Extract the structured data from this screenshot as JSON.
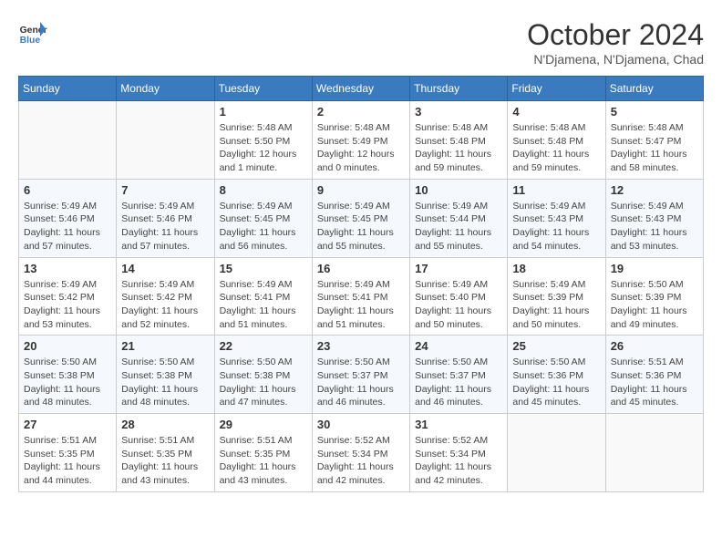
{
  "header": {
    "logo": {
      "line1": "General",
      "line2": "Blue"
    },
    "title": "October 2024",
    "location": "N'Djamena, N'Djamena, Chad"
  },
  "weekdays": [
    "Sunday",
    "Monday",
    "Tuesday",
    "Wednesday",
    "Thursday",
    "Friday",
    "Saturday"
  ],
  "weeks": [
    [
      {
        "day": "",
        "info": ""
      },
      {
        "day": "",
        "info": ""
      },
      {
        "day": "1",
        "info": "Sunrise: 5:48 AM\nSunset: 5:50 PM\nDaylight: 12 hours\nand 1 minute."
      },
      {
        "day": "2",
        "info": "Sunrise: 5:48 AM\nSunset: 5:49 PM\nDaylight: 12 hours\nand 0 minutes."
      },
      {
        "day": "3",
        "info": "Sunrise: 5:48 AM\nSunset: 5:48 PM\nDaylight: 11 hours\nand 59 minutes."
      },
      {
        "day": "4",
        "info": "Sunrise: 5:48 AM\nSunset: 5:48 PM\nDaylight: 11 hours\nand 59 minutes."
      },
      {
        "day": "5",
        "info": "Sunrise: 5:48 AM\nSunset: 5:47 PM\nDaylight: 11 hours\nand 58 minutes."
      }
    ],
    [
      {
        "day": "6",
        "info": "Sunrise: 5:49 AM\nSunset: 5:46 PM\nDaylight: 11 hours\nand 57 minutes."
      },
      {
        "day": "7",
        "info": "Sunrise: 5:49 AM\nSunset: 5:46 PM\nDaylight: 11 hours\nand 57 minutes."
      },
      {
        "day": "8",
        "info": "Sunrise: 5:49 AM\nSunset: 5:45 PM\nDaylight: 11 hours\nand 56 minutes."
      },
      {
        "day": "9",
        "info": "Sunrise: 5:49 AM\nSunset: 5:45 PM\nDaylight: 11 hours\nand 55 minutes."
      },
      {
        "day": "10",
        "info": "Sunrise: 5:49 AM\nSunset: 5:44 PM\nDaylight: 11 hours\nand 55 minutes."
      },
      {
        "day": "11",
        "info": "Sunrise: 5:49 AM\nSunset: 5:43 PM\nDaylight: 11 hours\nand 54 minutes."
      },
      {
        "day": "12",
        "info": "Sunrise: 5:49 AM\nSunset: 5:43 PM\nDaylight: 11 hours\nand 53 minutes."
      }
    ],
    [
      {
        "day": "13",
        "info": "Sunrise: 5:49 AM\nSunset: 5:42 PM\nDaylight: 11 hours\nand 53 minutes."
      },
      {
        "day": "14",
        "info": "Sunrise: 5:49 AM\nSunset: 5:42 PM\nDaylight: 11 hours\nand 52 minutes."
      },
      {
        "day": "15",
        "info": "Sunrise: 5:49 AM\nSunset: 5:41 PM\nDaylight: 11 hours\nand 51 minutes."
      },
      {
        "day": "16",
        "info": "Sunrise: 5:49 AM\nSunset: 5:41 PM\nDaylight: 11 hours\nand 51 minutes."
      },
      {
        "day": "17",
        "info": "Sunrise: 5:49 AM\nSunset: 5:40 PM\nDaylight: 11 hours\nand 50 minutes."
      },
      {
        "day": "18",
        "info": "Sunrise: 5:49 AM\nSunset: 5:39 PM\nDaylight: 11 hours\nand 50 minutes."
      },
      {
        "day": "19",
        "info": "Sunrise: 5:50 AM\nSunset: 5:39 PM\nDaylight: 11 hours\nand 49 minutes."
      }
    ],
    [
      {
        "day": "20",
        "info": "Sunrise: 5:50 AM\nSunset: 5:38 PM\nDaylight: 11 hours\nand 48 minutes."
      },
      {
        "day": "21",
        "info": "Sunrise: 5:50 AM\nSunset: 5:38 PM\nDaylight: 11 hours\nand 48 minutes."
      },
      {
        "day": "22",
        "info": "Sunrise: 5:50 AM\nSunset: 5:38 PM\nDaylight: 11 hours\nand 47 minutes."
      },
      {
        "day": "23",
        "info": "Sunrise: 5:50 AM\nSunset: 5:37 PM\nDaylight: 11 hours\nand 46 minutes."
      },
      {
        "day": "24",
        "info": "Sunrise: 5:50 AM\nSunset: 5:37 PM\nDaylight: 11 hours\nand 46 minutes."
      },
      {
        "day": "25",
        "info": "Sunrise: 5:50 AM\nSunset: 5:36 PM\nDaylight: 11 hours\nand 45 minutes."
      },
      {
        "day": "26",
        "info": "Sunrise: 5:51 AM\nSunset: 5:36 PM\nDaylight: 11 hours\nand 45 minutes."
      }
    ],
    [
      {
        "day": "27",
        "info": "Sunrise: 5:51 AM\nSunset: 5:35 PM\nDaylight: 11 hours\nand 44 minutes."
      },
      {
        "day": "28",
        "info": "Sunrise: 5:51 AM\nSunset: 5:35 PM\nDaylight: 11 hours\nand 43 minutes."
      },
      {
        "day": "29",
        "info": "Sunrise: 5:51 AM\nSunset: 5:35 PM\nDaylight: 11 hours\nand 43 minutes."
      },
      {
        "day": "30",
        "info": "Sunrise: 5:52 AM\nSunset: 5:34 PM\nDaylight: 11 hours\nand 42 minutes."
      },
      {
        "day": "31",
        "info": "Sunrise: 5:52 AM\nSunset: 5:34 PM\nDaylight: 11 hours\nand 42 minutes."
      },
      {
        "day": "",
        "info": ""
      },
      {
        "day": "",
        "info": ""
      }
    ]
  ]
}
